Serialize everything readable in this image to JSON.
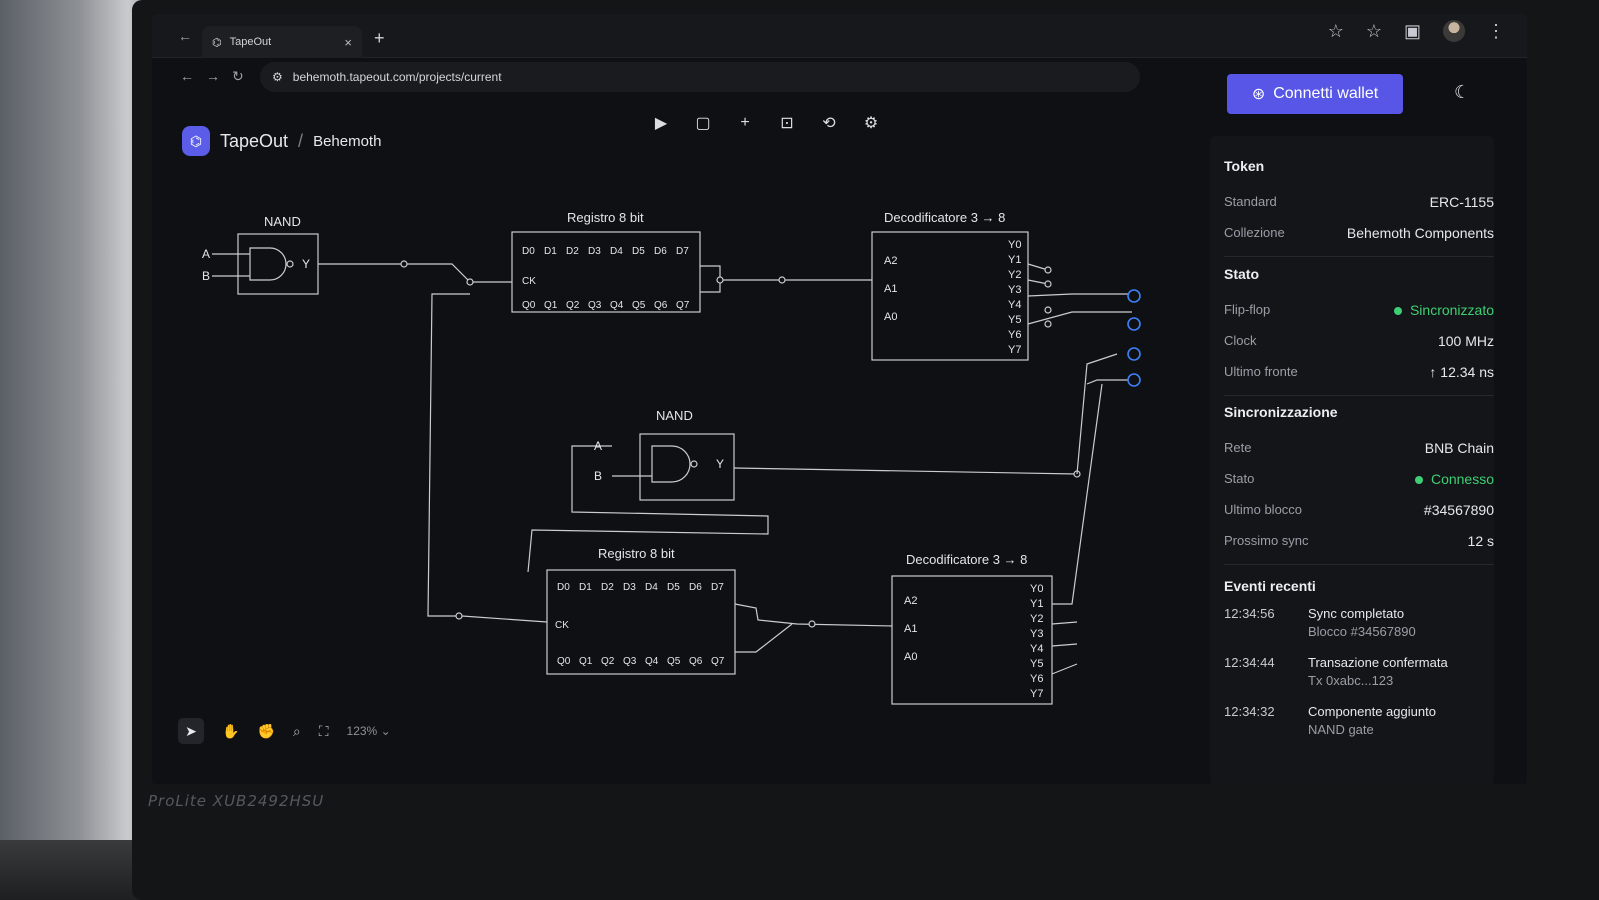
{
  "browser": {
    "tab_title": "TapeOut",
    "tab_close": "×",
    "new_tab": "+",
    "url": "behemoth.tapeout.com/projects/current"
  },
  "app": {
    "name": "TapeOut",
    "separator": "/",
    "project": "Behemoth"
  },
  "diagram": {
    "nand_top_title": "NAND",
    "nand_mid_title": "NAND",
    "pin_a": "A",
    "pin_b": "B",
    "pin_y": "Y",
    "reg_top_title": "Registro 8 bit",
    "reg_bottom_title": "Registro 8 bit",
    "dec_top_title": "Decodificatore 3 → 8",
    "dec_bottom_title": "Decodificatore 3 → 8",
    "reg_inputs": [
      "D0",
      "D1",
      "D2",
      "D3",
      "D4",
      "D5",
      "D6",
      "D7"
    ],
    "reg_outputs": [
      "Q0",
      "Q1",
      "Q2",
      "Q3",
      "Q4",
      "Q5",
      "Q6",
      "Q7"
    ],
    "reg_clock": "CK",
    "dec_inputs": [
      "A2",
      "A1",
      "A0"
    ],
    "dec_outputs": [
      "Y0",
      "Y1",
      "Y2",
      "Y3",
      "Y4",
      "Y5",
      "Y6",
      "Y7"
    ]
  },
  "canvas_tools": {
    "zoom": "123%"
  },
  "sidebar": {
    "wallet_button": "Connetti wallet",
    "token": {
      "title": "Token",
      "rows": [
        {
          "k": "Standard",
          "v": "ERC-1155"
        },
        {
          "k": "Collezione",
          "v": "Behemoth Components"
        }
      ]
    },
    "stato": {
      "title": "Stato",
      "rows": [
        {
          "k": "Flip-flop",
          "v": "Sincronizzato"
        },
        {
          "k": "Clock",
          "v": "100 MHz"
        },
        {
          "k": "Ultimo fronte",
          "v": "↑ 12.34 ns"
        }
      ]
    },
    "sync": {
      "title": "Sincronizzazione",
      "rows": [
        {
          "k": "Rete",
          "v": "BNB Chain"
        },
        {
          "k": "Stato",
          "v": "Connesso"
        },
        {
          "k": "Ultimo blocco",
          "v": "#34567890"
        },
        {
          "k": "Prossimo sync",
          "v": "12 s"
        }
      ]
    },
    "events": {
      "title": "Eventi recenti",
      "items": [
        {
          "time": "12:34:56",
          "title": "Sync completato",
          "sub": "Blocco #34567890"
        },
        {
          "time": "12:34:44",
          "title": "Transazione confermata",
          "sub": "Tx 0xabc...123"
        },
        {
          "time": "12:34:32",
          "title": "Componente aggiunto",
          "sub": "NAND gate"
        }
      ]
    }
  },
  "monitor": {
    "brand": "ProLite XUB2492HSU"
  },
  "colors": {
    "accent": "#5756e6",
    "status_green": "#3ecf74",
    "port_blue": "#3b82f6"
  }
}
